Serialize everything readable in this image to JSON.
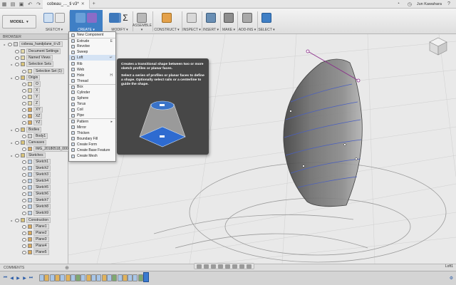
{
  "app": {
    "tab_title": "cobeau_..._ti v3*",
    "user": "Jun Kawahara",
    "help_icon": "help-icon"
  },
  "ribbon": {
    "workspace": "MODEL",
    "groups": [
      {
        "label": "SKETCH ▾"
      },
      {
        "label": "CREATE ▾"
      },
      {
        "label": "MODIFY ▾"
      },
      {
        "label": "ASSEMBLE ▾"
      },
      {
        "label": "CONSTRUCT ▾"
      },
      {
        "label": "INSPECT ▾"
      },
      {
        "label": "INSERT ▾"
      },
      {
        "label": "MAKE ▾"
      },
      {
        "label": "ADD-INS ▾"
      },
      {
        "label": "SELECT ▾"
      }
    ]
  },
  "browser": {
    "header": "BROWSER",
    "rows": [
      {
        "label": "cobeau_handplane_ti v3"
      },
      {
        "label": "Document Settings"
      },
      {
        "label": "Named Views"
      },
      {
        "label": "Selection Sets"
      },
      {
        "label": "Selection Set (1)"
      },
      {
        "label": "Origin"
      },
      {
        "label": "O"
      },
      {
        "label": "X"
      },
      {
        "label": "Y"
      },
      {
        "label": "Z"
      },
      {
        "label": "XY"
      },
      {
        "label": "XZ"
      },
      {
        "label": "YZ"
      },
      {
        "label": "Bodies"
      },
      {
        "label": "Body1"
      },
      {
        "label": "Canvases"
      },
      {
        "label": "IMG_20180518_0001"
      },
      {
        "label": "Sketches"
      },
      {
        "label": "Sketch1"
      },
      {
        "label": "Sketch2"
      },
      {
        "label": "Sketch3"
      },
      {
        "label": "Sketch4"
      },
      {
        "label": "Sketch5"
      },
      {
        "label": "Sketch6"
      },
      {
        "label": "Sketch7"
      },
      {
        "label": "Sketch8"
      },
      {
        "label": "Sketch9"
      },
      {
        "label": "Construction"
      },
      {
        "label": "Plane1"
      },
      {
        "label": "Plane2"
      },
      {
        "label": "Plane3"
      },
      {
        "label": "Plane4"
      },
      {
        "label": "Plane5"
      }
    ]
  },
  "create_menu": {
    "items": [
      {
        "label": "New Component",
        "shortcut": ""
      },
      {
        "label": "Extrude",
        "shortcut": "E"
      },
      {
        "label": "Revolve",
        "shortcut": ""
      },
      {
        "label": "Sweep",
        "shortcut": ""
      },
      {
        "label": "Loft",
        "shortcut": "↵"
      },
      {
        "label": "Rib",
        "shortcut": ""
      },
      {
        "label": "Web",
        "shortcut": ""
      },
      {
        "label": "Hole",
        "shortcut": "H"
      },
      {
        "label": "Thread",
        "shortcut": ""
      },
      {
        "label": "Box",
        "shortcut": ""
      },
      {
        "label": "Cylinder",
        "shortcut": ""
      },
      {
        "label": "Sphere",
        "shortcut": ""
      },
      {
        "label": "Torus",
        "shortcut": ""
      },
      {
        "label": "Coil",
        "shortcut": ""
      },
      {
        "label": "Pipe",
        "shortcut": ""
      },
      {
        "label": "Pattern",
        "shortcut": "▸"
      },
      {
        "label": "Mirror",
        "shortcut": ""
      },
      {
        "label": "Thicken",
        "shortcut": ""
      },
      {
        "label": "Boundary Fill",
        "shortcut": ""
      },
      {
        "label": "Create Form",
        "shortcut": ""
      },
      {
        "label": "Create Base Feature",
        "shortcut": ""
      },
      {
        "label": "Create Mesh",
        "shortcut": ""
      }
    ],
    "highlighted": 4
  },
  "tooltip": {
    "line1": "Creates a transitional shape between two or more sketch profiles or planar faces.",
    "line2": "Select a series of profiles or planar faces to define a shape. Optionally select rails or a centerline to guide the shape."
  },
  "comments": {
    "label": "COMMENTS"
  },
  "status": {
    "right": "Loft1"
  },
  "colors": {
    "accent": "#3f7fc5",
    "tooltip_bg": "#474747"
  }
}
